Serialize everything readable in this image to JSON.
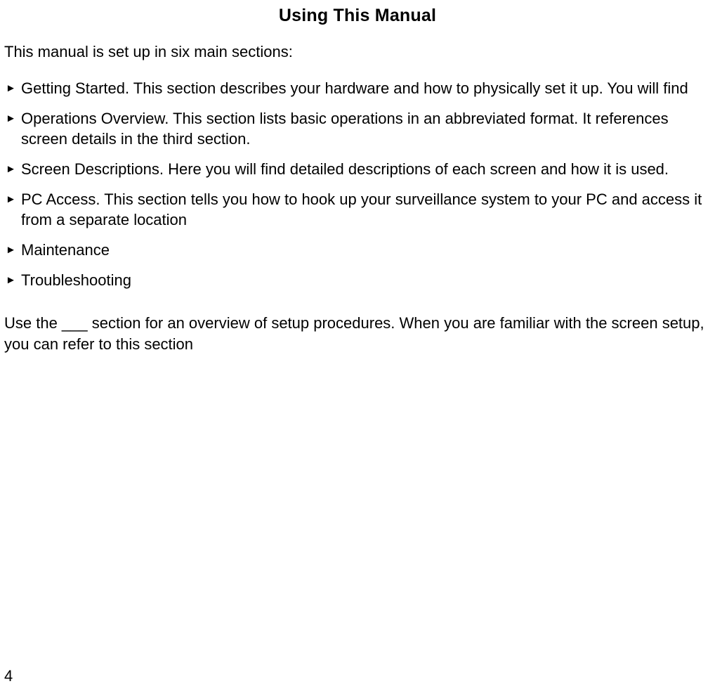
{
  "title": "Using This Manual",
  "intro": "This manual is set up in six main sections:",
  "bullets": [
    {
      "text": "Getting Started. This section describes your hardware and how to physically set it up. You will find"
    },
    {
      "text": "Operations Overview. This section lists basic operations in an abbreviated format. It references screen details in the third section."
    },
    {
      "text": "Screen Descriptions. Here you will find detailed descriptions of each screen and how it is used."
    },
    {
      "text": "PC Access. This section tells you how to hook up your surveillance system to your PC and access it from a separate location"
    },
    {
      "text": "Maintenance"
    },
    {
      "text": "Troubleshooting"
    }
  ],
  "bulletMarker": "►",
  "closing": "Use the ___ section for an overview of setup procedures. When you are familiar with the screen setup, you can refer to this section",
  "pageNumber": "4"
}
